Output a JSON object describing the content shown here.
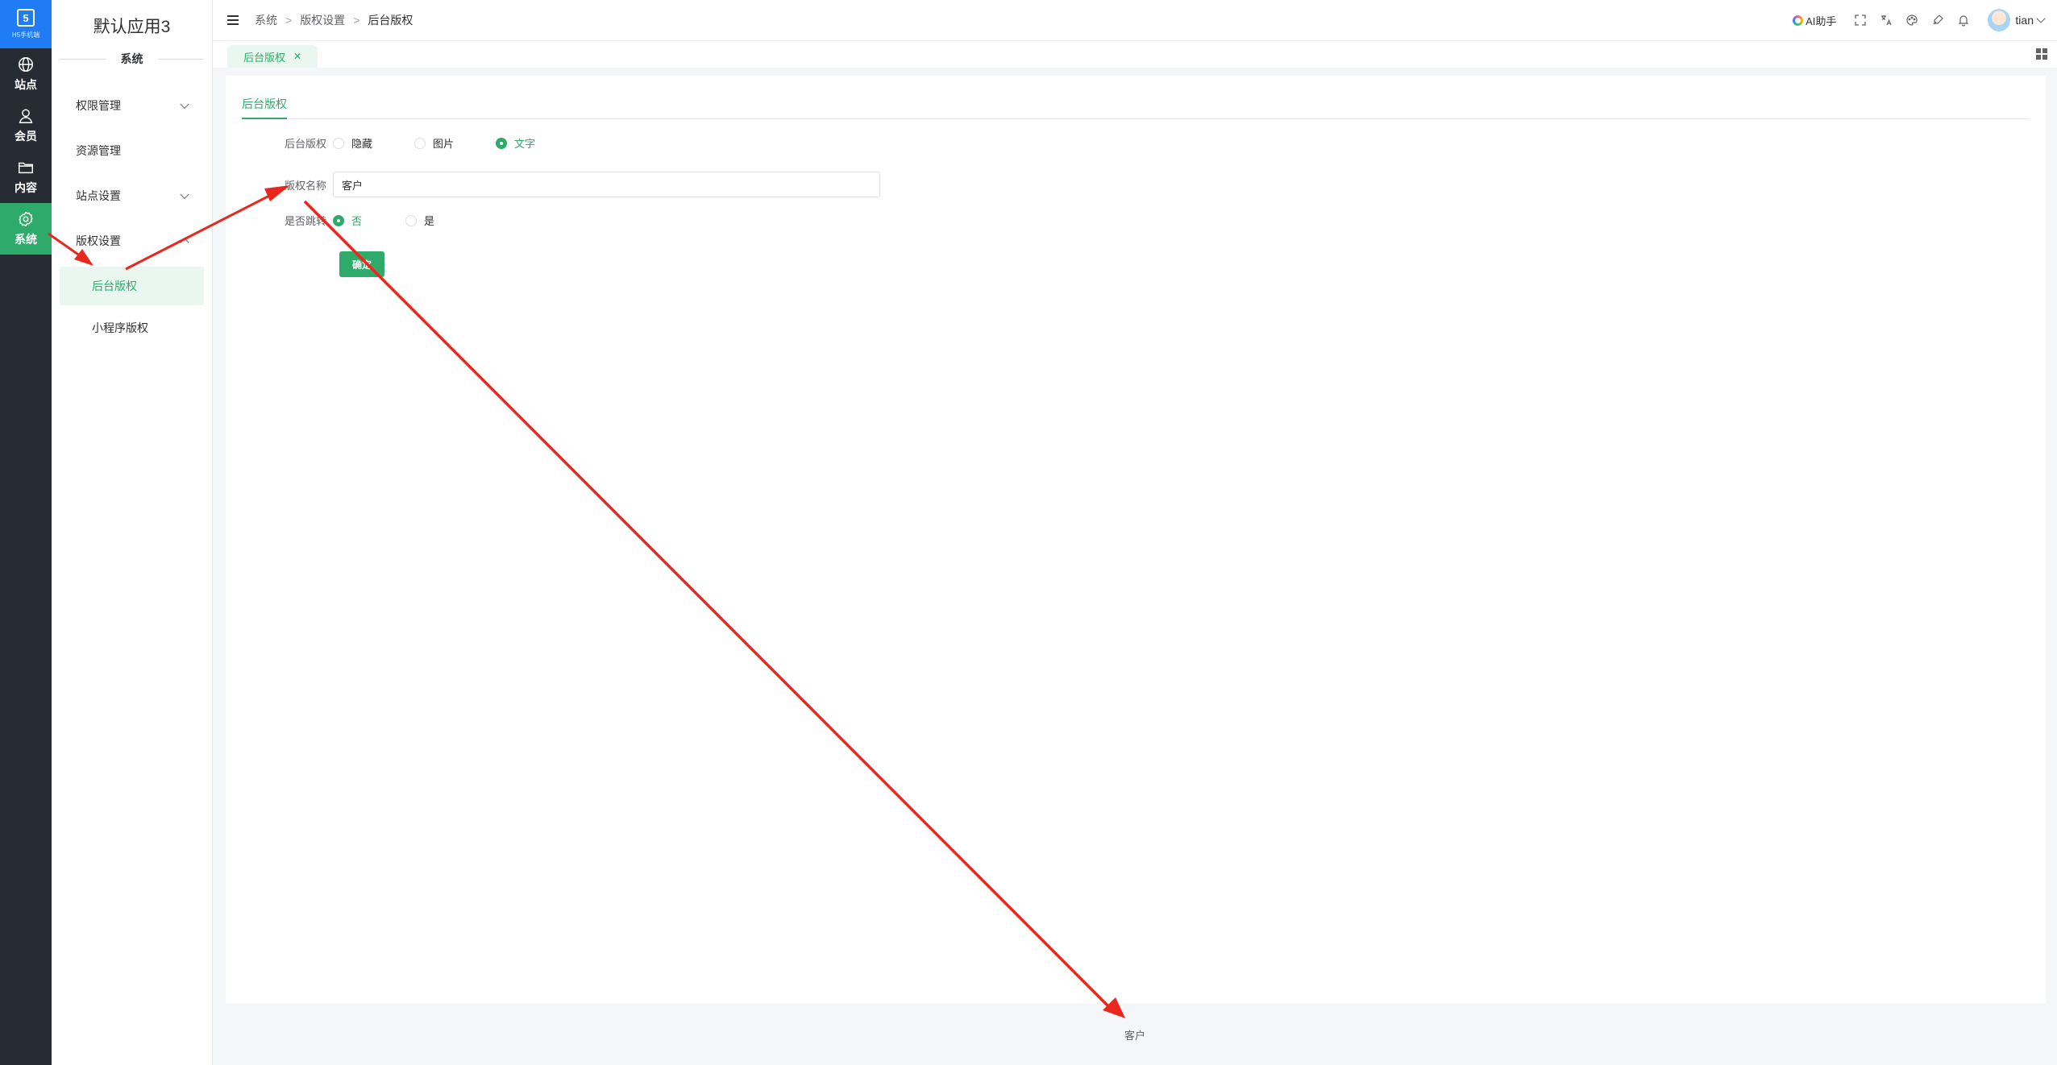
{
  "rail": {
    "logo_caption": "H5手机端",
    "items": [
      {
        "label": "站点",
        "icon": "globe-icon"
      },
      {
        "label": "会员",
        "icon": "user-icon"
      },
      {
        "label": "内容",
        "icon": "folder-icon"
      },
      {
        "label": "系统",
        "icon": "gear-icon",
        "active": true
      }
    ]
  },
  "sidebar": {
    "title": "默认应用3",
    "section": "系统",
    "items": [
      {
        "label": "权限管理"
      },
      {
        "label": "资源管理"
      },
      {
        "label": "站点设置"
      },
      {
        "label": "版权设置"
      }
    ],
    "sub_items": [
      {
        "label": "后台版权",
        "active": true
      },
      {
        "label": "小程序版权"
      }
    ]
  },
  "header": {
    "breadcrumb": [
      "系统",
      "版权设置",
      "后台版权"
    ],
    "ai_label": "AI助手",
    "username": "tian"
  },
  "tabs": [
    {
      "label": "后台版权"
    }
  ],
  "main": {
    "inner_tab": "后台版权",
    "copyright_type": {
      "label": "后台版权",
      "options": [
        "隐藏",
        "图片",
        "文字"
      ],
      "selected": "文字"
    },
    "copyright_name": {
      "label": "版权名称",
      "value": "客户"
    },
    "jump": {
      "label": "是否跳转",
      "options": [
        "否",
        "是"
      ],
      "selected": "否"
    },
    "confirm_label": "确定"
  },
  "footer": {
    "text": "客户"
  },
  "colors": {
    "accent": "#2eaa6b",
    "rail_bg": "#272b33",
    "logo_bg": "#1f7cf4",
    "annotation": "#e8281e"
  }
}
